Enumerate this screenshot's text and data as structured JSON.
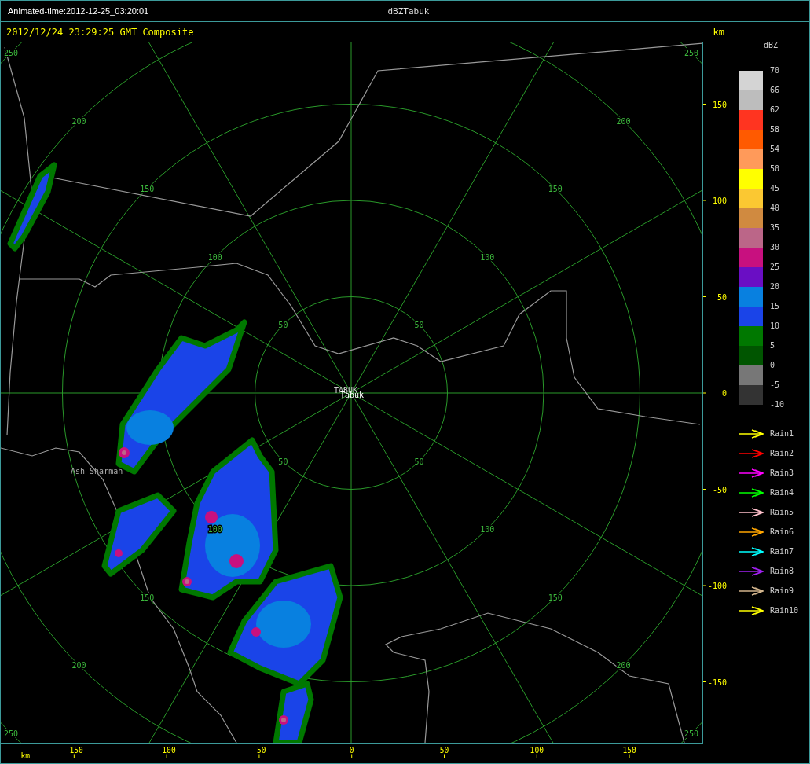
{
  "title_bar": {
    "animated_time": "Animated-time:2012-12-25_03:20:01",
    "product": "dBZTabuk"
  },
  "header": {
    "timestamp": "2012/12/24 23:29:25 GMT Composite",
    "unit": "km"
  },
  "map": {
    "rings": [
      {
        "labels": [
          "50",
          "50",
          "50",
          "50"
        ]
      },
      {
        "labels": [
          "100",
          "100",
          "100",
          "100"
        ]
      },
      {
        "labels": [
          "150",
          "150",
          "150",
          "150"
        ]
      },
      {
        "labels": [
          "200",
          "200",
          "200",
          "200"
        ]
      },
      {
        "labels": [
          "250",
          "250",
          "250",
          "250"
        ]
      }
    ],
    "places": [
      {
        "kind": "radar",
        "name": "TABUK"
      },
      {
        "kind": "city",
        "name": "Tabuk"
      },
      {
        "kind": "town",
        "name": "Ash_Sharmah"
      }
    ]
  },
  "y_axis": {
    "ticks": [
      "150",
      "100",
      "50",
      "0",
      "-50",
      "-100",
      "-150"
    ]
  },
  "x_axis": {
    "unit": "km",
    "ticks": [
      "-150",
      "-100",
      "-50",
      "0",
      "50",
      "100",
      "150"
    ]
  },
  "legend": {
    "title": "dBZ",
    "labels": [
      "70",
      "66",
      "62",
      "58",
      "54",
      "50",
      "45",
      "40",
      "35",
      "30",
      "25",
      "20",
      "15",
      "10",
      "5",
      "0",
      "-5",
      "-10"
    ],
    "bands": [
      {
        "color": "#d4d4d4"
      },
      {
        "color": "#bdbdbd"
      },
      {
        "color": "#ff3420"
      },
      {
        "color": "#ff5a00"
      },
      {
        "color": "#ff9a5a"
      },
      {
        "color": "#ffff00"
      },
      {
        "color": "#fbc832"
      },
      {
        "color": "#d08a40"
      },
      {
        "color": "#bb6688"
      },
      {
        "color": "#c8107f"
      },
      {
        "color": "#6a0ec4"
      },
      {
        "color": "#0880e0"
      },
      {
        "color": "#1a44e8"
      },
      {
        "color": "#007800"
      },
      {
        "color": "#005500"
      },
      {
        "color": "#777777"
      },
      {
        "color": "#333333"
      }
    ],
    "tracks": [
      {
        "label": "Rain1",
        "color": "#ffff00"
      },
      {
        "label": "Rain2",
        "color": "#ff0000"
      },
      {
        "label": "Rain3",
        "color": "#ff00ff"
      },
      {
        "label": "Rain4",
        "color": "#00ff00"
      },
      {
        "label": "Rain5",
        "color": "#ffc0cb"
      },
      {
        "label": "Rain6",
        "color": "#ffa500"
      },
      {
        "label": "Rain7",
        "color": "#00ffff"
      },
      {
        "label": "Rain8",
        "color": "#a020f0"
      },
      {
        "label": "Rain9",
        "color": "#d2b48c"
      },
      {
        "label": "Rain10",
        "color": "#ffff00"
      }
    ]
  }
}
